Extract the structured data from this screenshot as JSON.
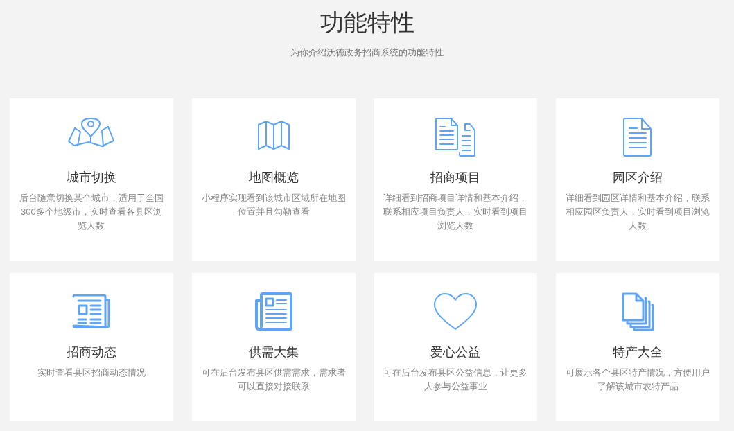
{
  "header": {
    "title": "功能特性",
    "subtitle": "为你介绍沃德政务招商系统的功能特性"
  },
  "features": [
    {
      "kind": "map-pin",
      "title": "城市切换",
      "description": "后台随意切换某个城市，适用于全国300多个地级市，实时查看各县区浏览人数"
    },
    {
      "kind": "map",
      "title": "地图概览",
      "description": "小程序实现看到该城市区域所在地图位置并且勾勒查看"
    },
    {
      "kind": "documents",
      "title": "招商项目",
      "description": "详细看到招商项目详情和基本介绍，联系相应项目负责人，实时看到项目浏览人数"
    },
    {
      "kind": "document",
      "title": "园区介绍",
      "description": "详细看到园区详情和基本介绍，联系相应园区负责人，实时看到项目浏览人数"
    },
    {
      "kind": "newspaper",
      "title": "招商动态",
      "description": "实时查看县区招商动态情况"
    },
    {
      "kind": "newspaper-bold",
      "title": "供需大集",
      "description": "可在后台发布县区供需需求，需求者可以直接对接联系"
    },
    {
      "kind": "heart",
      "title": "爱心公益",
      "description": "可在后台发布县区公益信息，让更多人参与公益事业"
    },
    {
      "kind": "stack",
      "title": "特产大全",
      "description": "可展示各个县区特产情况，方便用户了解该城市农特产品"
    }
  ]
}
